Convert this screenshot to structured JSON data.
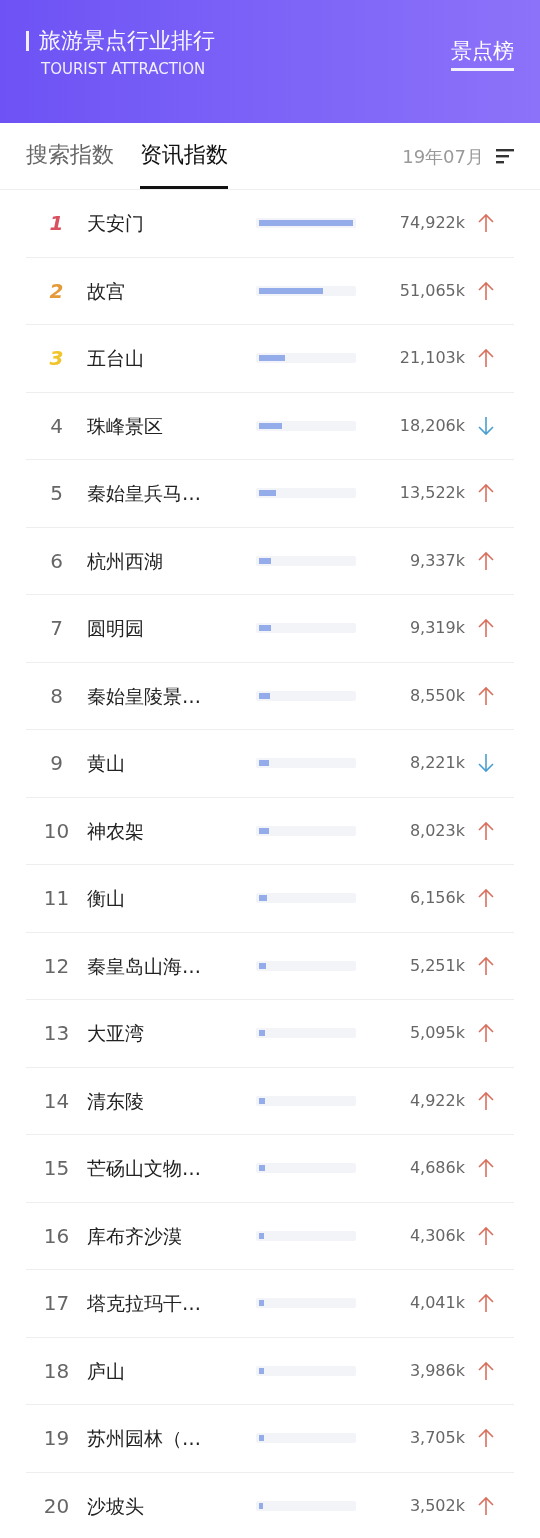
{
  "header": {
    "title": "旅游景点行业排行",
    "subtitle": "TOURIST ATTRACTION",
    "link": "景点榜"
  },
  "tabs": [
    {
      "label": "搜索指数",
      "selected": false
    },
    {
      "label": "资讯指数",
      "selected": true
    }
  ],
  "period": "19年07月",
  "rows": [
    {
      "rank": "1",
      "color": "#d9505e",
      "name": "天安门",
      "level": 1.0,
      "value": "74,922k",
      "rising": true
    },
    {
      "rank": "2",
      "color": "#e59a3a",
      "name": "故宫",
      "level": 0.68,
      "value": "51,065k",
      "rising": true
    },
    {
      "rank": "3",
      "color": "#f0c42a",
      "name": "五台山",
      "level": 0.28,
      "value": "21,103k",
      "rising": true
    },
    {
      "rank": "4",
      "color": "#666666",
      "name": "珠峰景区",
      "level": 0.24,
      "value": "18,206k",
      "rising": false
    },
    {
      "rank": "5",
      "color": "#666666",
      "name": "秦始皇兵马…",
      "level": 0.18,
      "value": "13,522k",
      "rising": true
    },
    {
      "rank": "6",
      "color": "#666666",
      "name": "杭州西湖",
      "level": 0.125,
      "value": "9,337k",
      "rising": true
    },
    {
      "rank": "7",
      "color": "#666666",
      "name": "圆明园",
      "level": 0.124,
      "value": "9,319k",
      "rising": true
    },
    {
      "rank": "8",
      "color": "#666666",
      "name": "秦始皇陵景…",
      "level": 0.114,
      "value": "8,550k",
      "rising": true
    },
    {
      "rank": "9",
      "color": "#666666",
      "name": "黄山",
      "level": 0.11,
      "value": "8,221k",
      "rising": false
    },
    {
      "rank": "10",
      "color": "#666666",
      "name": "神农架",
      "level": 0.107,
      "value": "8,023k",
      "rising": true
    },
    {
      "rank": "11",
      "color": "#666666",
      "name": "衡山",
      "level": 0.082,
      "value": "6,156k",
      "rising": true
    },
    {
      "rank": "12",
      "color": "#666666",
      "name": "秦皇岛山海…",
      "level": 0.07,
      "value": "5,251k",
      "rising": true
    },
    {
      "rank": "13",
      "color": "#666666",
      "name": "大亚湾",
      "level": 0.068,
      "value": "5,095k",
      "rising": true
    },
    {
      "rank": "14",
      "color": "#666666",
      "name": "清东陵",
      "level": 0.066,
      "value": "4,922k",
      "rising": true
    },
    {
      "rank": "15",
      "color": "#666666",
      "name": "芒砀山文物…",
      "level": 0.063,
      "value": "4,686k",
      "rising": true
    },
    {
      "rank": "16",
      "color": "#666666",
      "name": "库布齐沙漠",
      "level": 0.057,
      "value": "4,306k",
      "rising": true
    },
    {
      "rank": "17",
      "color": "#666666",
      "name": "塔克拉玛干…",
      "level": 0.054,
      "value": "4,041k",
      "rising": true
    },
    {
      "rank": "18",
      "color": "#666666",
      "name": "庐山",
      "level": 0.053,
      "value": "3,986k",
      "rising": true
    },
    {
      "rank": "19",
      "color": "#666666",
      "name": "苏州园林（…",
      "level": 0.049,
      "value": "3,705k",
      "rising": true
    },
    {
      "rank": "20",
      "color": "#666666",
      "name": "沙坡头",
      "level": 0.047,
      "value": "3,502k",
      "rising": true
    }
  ]
}
